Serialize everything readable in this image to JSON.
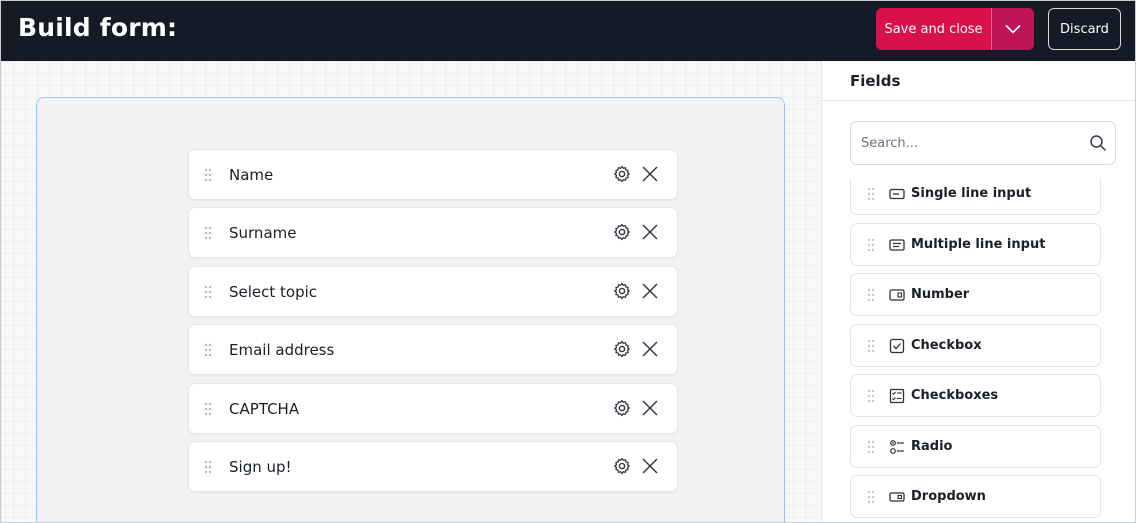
{
  "header": {
    "title": "Build form:",
    "save_label": "Save and close",
    "discard_label": "Discard"
  },
  "form": {
    "fields": [
      {
        "label": "Name"
      },
      {
        "label": "Surname"
      },
      {
        "label": "Select topic"
      },
      {
        "label": "Email address"
      },
      {
        "label": "CAPTCHA"
      },
      {
        "label": "Sign up!"
      }
    ]
  },
  "sidebar": {
    "title": "Fields",
    "search_placeholder": "Search...",
    "items": [
      {
        "label": "Single line input",
        "icon": "single-line-input-icon"
      },
      {
        "label": "Multiple line input",
        "icon": "multiple-line-input-icon"
      },
      {
        "label": "Number",
        "icon": "number-icon"
      },
      {
        "label": "Checkbox",
        "icon": "checkbox-icon"
      },
      {
        "label": "Checkboxes",
        "icon": "checkboxes-icon"
      },
      {
        "label": "Radio",
        "icon": "radio-icon"
      },
      {
        "label": "Dropdown",
        "icon": "dropdown-icon"
      }
    ]
  },
  "colors": {
    "header_bg": "#141b26",
    "primary": "#d8114a",
    "form_border": "#9cc4ee"
  }
}
